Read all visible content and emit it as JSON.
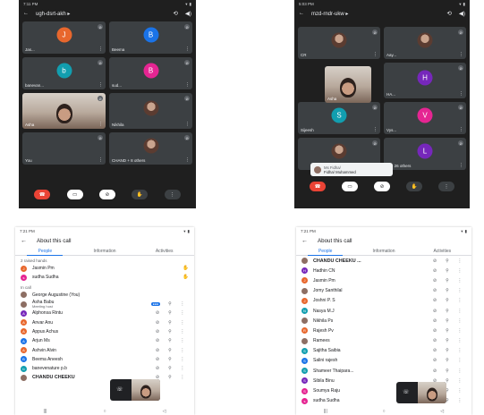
{
  "colors": {
    "accent": "#1a73e8",
    "end_call": "#ea4335",
    "dark_bg": "#1f1f1f",
    "tile_bg": "#3c4043"
  },
  "screen1": {
    "status_time": "7:11 PM",
    "meeting_code": "ugh-dsrt-akh",
    "tiles": [
      {
        "initial": "J",
        "name": "Jas...",
        "color": "#e8672d",
        "photo": false
      },
      {
        "initial": "B",
        "name": "Beema",
        "color": "#1a73e8",
        "photo": false
      },
      {
        "initial": "b",
        "name": "banevan...",
        "color": "#129eaf",
        "photo": false
      },
      {
        "initial": "B",
        "name": "sud...",
        "color": "#e52592",
        "photo": false
      },
      {
        "initial": "",
        "name": "Asha",
        "color": "",
        "photo": true,
        "video": true
      },
      {
        "initial": "",
        "name": "Nikhila",
        "color": "",
        "photo": true,
        "video": false
      },
      {
        "initial": "",
        "name": "You",
        "color": "#3c4043",
        "photo": false,
        "video": false
      },
      {
        "initial": "",
        "name": "CHAND + 8 others",
        "color": "",
        "photo": true,
        "video": false
      }
    ]
  },
  "screen2": {
    "status_time": "5:03 PM",
    "meeting_code": "mzd-rndr-ukw",
    "tiles": [
      {
        "initial": "",
        "name": "CR",
        "photo": true,
        "color": ""
      },
      {
        "initial": "",
        "name": "Aay...",
        "photo": true,
        "color": ""
      },
      {
        "initial": "",
        "name": "",
        "photo": false,
        "color": "",
        "blank": true
      },
      {
        "initial": "H",
        "name": "HA...",
        "photo": false,
        "color": "#7627bb"
      },
      {
        "initial": "S",
        "name": "Sijeesh",
        "photo": false,
        "color": "#129eaf"
      },
      {
        "initial": "V",
        "name": "Vys...",
        "photo": false,
        "color": "#e52592"
      },
      {
        "initial": "",
        "name": "",
        "photo": true,
        "color": ""
      },
      {
        "initial": "L",
        "name": "Li + 26 others",
        "photo": false,
        "color": "#7627bb"
      }
    ],
    "self_name": "Asha",
    "toast_line1": "Ms Fidha/",
    "toast_line2": "Fidha/ Muhammed"
  },
  "screen3": {
    "status_time": "7:21 PM",
    "title": "About this call",
    "tabs": [
      "People",
      "Information",
      "Activities"
    ],
    "raised_label": "2 raised hands",
    "raised": [
      {
        "name": "Jasmin Pm",
        "color": "#e8672d",
        "initial": "J"
      },
      {
        "name": "sudha Sudha",
        "color": "#e52592",
        "initial": "s"
      }
    ],
    "incall_label": "In call",
    "people": [
      {
        "name": "George Augustine (You)",
        "color": "#8d6e63",
        "initial": "",
        "sub": ""
      },
      {
        "name": "Asha Babu",
        "color": "#8d6e63",
        "initial": "",
        "sub": "Meeting host",
        "badge": "●●●"
      },
      {
        "name": "Alphonsa Rintu",
        "color": "#7627bb",
        "initial": "A",
        "sub": ""
      },
      {
        "name": "Anvar Anu",
        "color": "#e8672d",
        "initial": "A",
        "sub": ""
      },
      {
        "name": "Appus Achus",
        "color": "#e8672d",
        "initial": "A",
        "sub": ""
      },
      {
        "name": "Arjun Ms",
        "color": "#1a73e8",
        "initial": "A",
        "sub": ""
      },
      {
        "name": "Ashvin Alvin",
        "color": "#e8672d",
        "initial": "A",
        "sub": ""
      },
      {
        "name": "Beema Aneesh",
        "color": "#1a73e8",
        "initial": "B",
        "sub": ""
      },
      {
        "name": "banevenature p.b",
        "color": "#129eaf",
        "initial": "b",
        "sub": ""
      },
      {
        "name": "CHANDU CHEEKU",
        "color": "#8d6e63",
        "initial": "",
        "sub": "",
        "bold": true
      }
    ]
  },
  "screen4": {
    "status_time": "7:21 PM",
    "title": "About this call",
    "tabs": [
      "People",
      "Information",
      "Activities"
    ],
    "people": [
      {
        "name": "CHANDU CHEEKU ...",
        "color": "#8d6e63",
        "initial": "",
        "bold": true
      },
      {
        "name": "Hadhin CN",
        "color": "#7627bb",
        "initial": "H"
      },
      {
        "name": "Jasmin Pm",
        "color": "#e8672d",
        "initial": "J"
      },
      {
        "name": "Jomy Santhilal",
        "color": "#8d6e63",
        "initial": ""
      },
      {
        "name": "Joshni P. S",
        "color": "#e8672d",
        "initial": "J"
      },
      {
        "name": "Nasya M.J",
        "color": "#129eaf",
        "initial": "N"
      },
      {
        "name": "Nikhila Ps",
        "color": "#8d6e63",
        "initial": ""
      },
      {
        "name": "Rajesh Pv",
        "color": "#e8672d",
        "initial": "R"
      },
      {
        "name": "Ramees",
        "color": "#8d6e63",
        "initial": ""
      },
      {
        "name": "Sajitha Saibia",
        "color": "#129eaf",
        "initial": "S"
      },
      {
        "name": "Salini rajesh",
        "color": "#1a73e8",
        "initial": "S"
      },
      {
        "name": "Shameer Thaipara...",
        "color": "#129eaf",
        "initial": "S"
      },
      {
        "name": "Sibila Binu",
        "color": "#7627bb",
        "initial": "S"
      },
      {
        "name": "Soumya Raju",
        "color": "#e52592",
        "initial": "S"
      },
      {
        "name": "sudha Sudha",
        "color": "#e52592",
        "initial": "s"
      }
    ]
  }
}
